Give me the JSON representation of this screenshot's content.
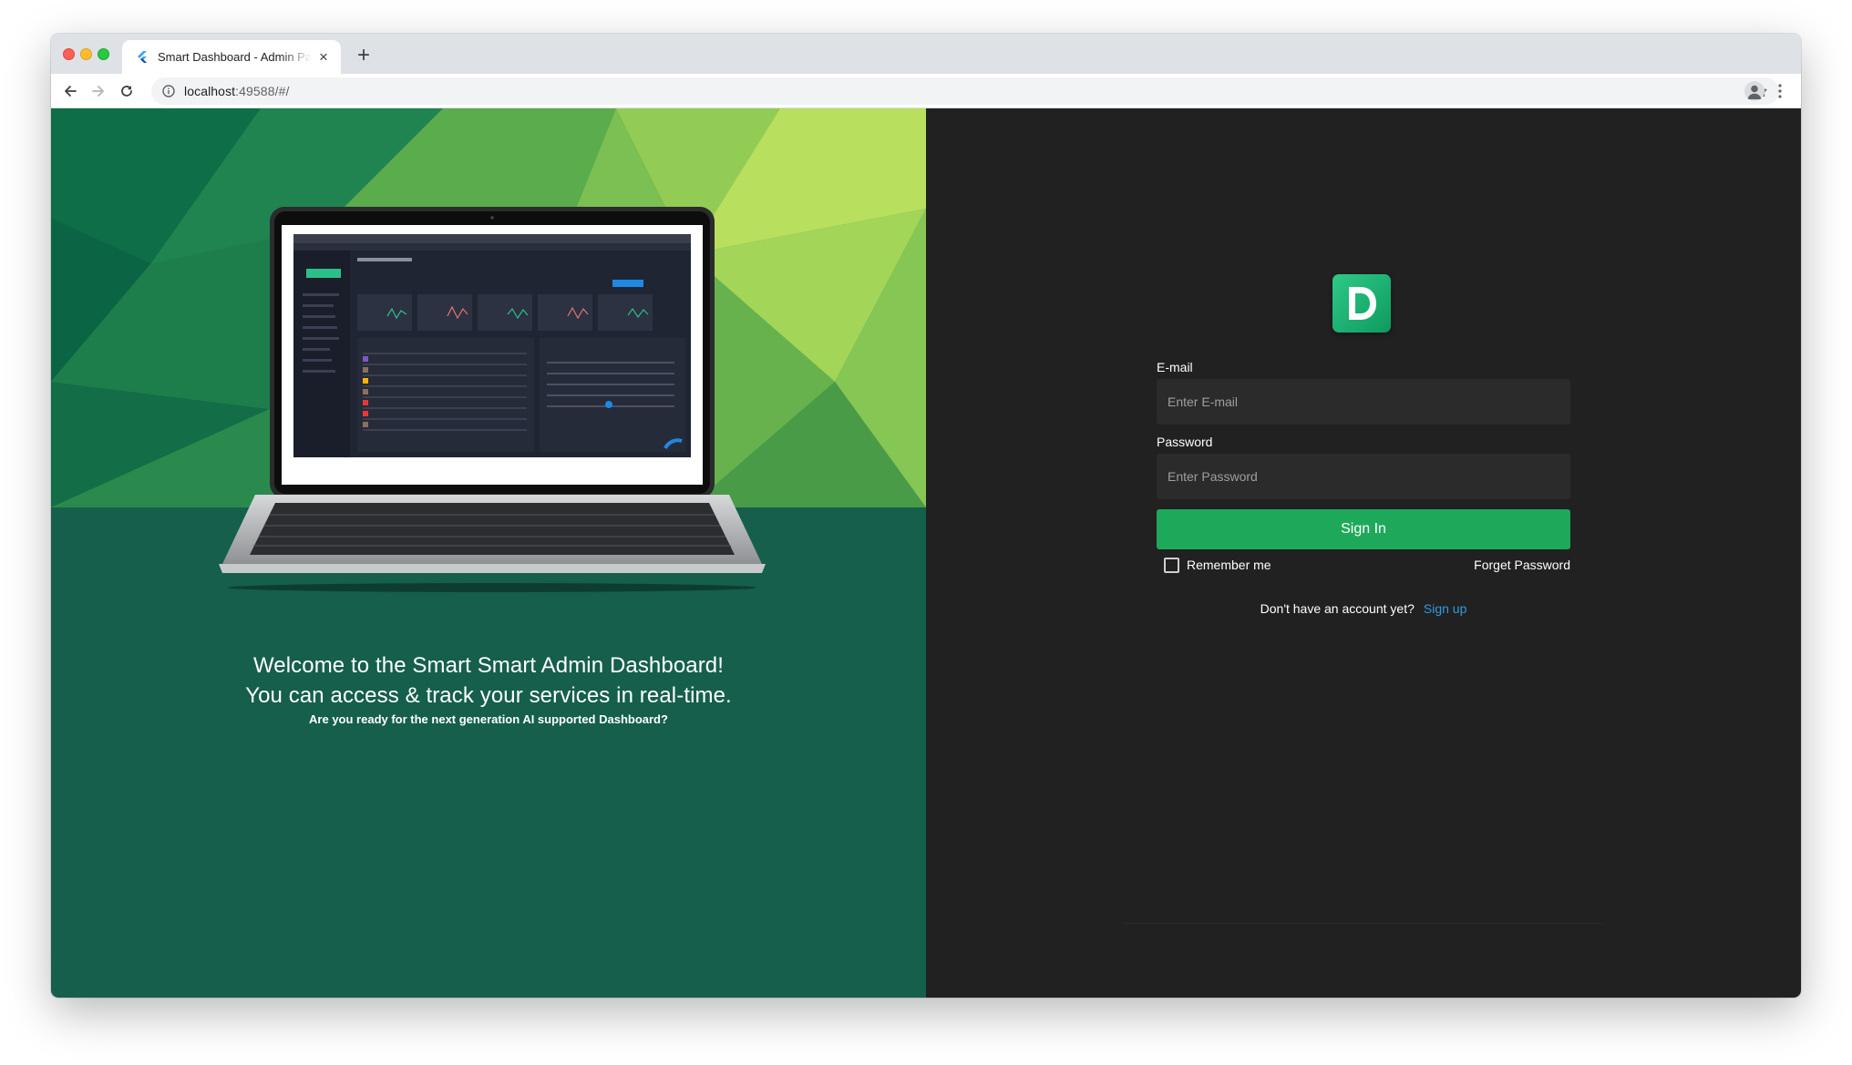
{
  "browser": {
    "tab_title": "Smart Dashboard - Admin Panel",
    "new_tab_symbol": "+",
    "close_symbol": "×",
    "url_host": "localhost",
    "url_rest": ":49588/#/"
  },
  "hero": {
    "line1": "Welcome to the Smart Smart Admin Dashboard!",
    "line2": "You can access & track your services in real-time.",
    "line3": "Are you ready for the next generation AI supported Dashboard?",
    "bg_color": "#155f4c"
  },
  "login": {
    "logo_letter": "D",
    "email_label": "E-mail",
    "email_placeholder": "Enter E-mail",
    "email_value": "",
    "password_label": "Password",
    "password_placeholder": "Enter Password",
    "password_value": "",
    "signin_label": "Sign In",
    "remember_label": "Remember me",
    "remember_checked": false,
    "forget_label": "Forget Password",
    "no_account_text": "Don't have an account yet?",
    "signup_label": "Sign up",
    "accent_color": "#1ea95a",
    "link_color": "#2f9be0",
    "panel_bg": "#212121"
  }
}
